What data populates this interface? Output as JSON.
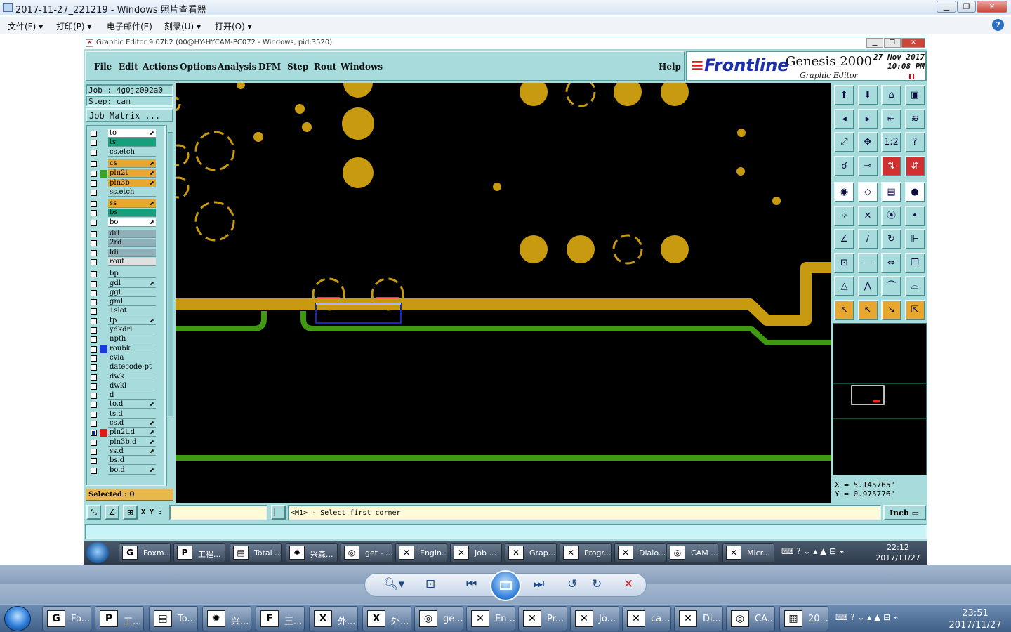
{
  "viewer": {
    "title": "2017-11-27_221219 - Windows 照片查看器",
    "menu": [
      "文件(F)",
      "打印(P)",
      "电子邮件(E)",
      "刻录(U)",
      "打开(O)"
    ],
    "help_icon": "?"
  },
  "genesis": {
    "title": "Graphic Editor 9.07b2 (00@HY-HYCAM-PC072 - Windows, pid:3520)",
    "menu": [
      "File",
      "Edit",
      "Actions",
      "Options",
      "Analysis",
      "DFM",
      "Step",
      "Rout",
      "Windows"
    ],
    "help": "Help",
    "brand": {
      "logo": "Frontline",
      "product": "Genesis 2000",
      "subtitle": "Graphic Editor",
      "date_line1": "27 Nov 2017",
      "date_line2": "10:08 PM"
    },
    "job_label": "Job : 4g0jz092a0",
    "step_label": "Step: cam",
    "job_matrix_button": "Job Matrix ...",
    "layers": [
      {
        "name": "to",
        "color": "#ffffff",
        "edit": "⬈",
        "checked": false,
        "swatch": null
      },
      {
        "name": "ts",
        "color": "#14a07a",
        "edit": "",
        "checked": false,
        "swatch": null
      },
      {
        "name": "cs.etch",
        "color": "#a8dcdc",
        "edit": "",
        "checked": false,
        "swatch": null
      },
      {
        "name": "cs",
        "color": "#e8a830",
        "edit": "⬈",
        "checked": false,
        "swatch": null
      },
      {
        "name": "pln2t",
        "color": "#e8a830",
        "edit": "⬈",
        "checked": false,
        "swatch": "#3aa02a"
      },
      {
        "name": "pln3b",
        "color": "#e8a830",
        "edit": "⬈",
        "checked": false,
        "swatch": null
      },
      {
        "name": "ss.etch",
        "color": "#a8dcdc",
        "edit": "",
        "checked": false,
        "swatch": null
      },
      {
        "name": "ss",
        "color": "#e8a830",
        "edit": "⬈",
        "checked": false,
        "swatch": null
      },
      {
        "name": "bs",
        "color": "#14a07a",
        "edit": "",
        "checked": false,
        "swatch": null
      },
      {
        "name": "bo",
        "color": "#ffffff",
        "edit": "⬈",
        "checked": false,
        "swatch": null
      },
      {
        "name": "drl",
        "color": "#8fb0b8",
        "edit": "",
        "checked": false,
        "swatch": null
      },
      {
        "name": "2rd",
        "color": "#8fb0b8",
        "edit": "",
        "checked": false,
        "swatch": null
      },
      {
        "name": "ldi",
        "color": "#8fb0b8",
        "edit": "",
        "checked": false,
        "swatch": null
      },
      {
        "name": "rout",
        "color": "#e0e0e0",
        "edit": "",
        "checked": false,
        "swatch": null
      },
      {
        "name": "bp",
        "color": "#a8dcdc",
        "edit": "",
        "checked": false,
        "swatch": null
      },
      {
        "name": "gdl",
        "color": "#a8dcdc",
        "edit": "⬈",
        "checked": false,
        "swatch": null
      },
      {
        "name": "ggl",
        "color": "#a8dcdc",
        "edit": "",
        "checked": false,
        "swatch": null
      },
      {
        "name": "gml",
        "color": "#a8dcdc",
        "edit": "",
        "checked": false,
        "swatch": null
      },
      {
        "name": "1slot",
        "color": "#a8dcdc",
        "edit": "",
        "checked": false,
        "swatch": null
      },
      {
        "name": "tp",
        "color": "#a8dcdc",
        "edit": "⬈",
        "checked": false,
        "swatch": null
      },
      {
        "name": "ydkdrl",
        "color": "#a8dcdc",
        "edit": "",
        "checked": false,
        "swatch": null
      },
      {
        "name": "npth",
        "color": "#a8dcdc",
        "edit": "",
        "checked": false,
        "swatch": null
      },
      {
        "name": "roubk",
        "color": "#a8dcdc",
        "edit": "",
        "checked": false,
        "swatch": "#1a3ae0"
      },
      {
        "name": "cvia",
        "color": "#a8dcdc",
        "edit": "",
        "checked": false,
        "swatch": null
      },
      {
        "name": "datecode-pt",
        "color": "#a8dcdc",
        "edit": "",
        "checked": false,
        "swatch": null
      },
      {
        "name": "dwk",
        "color": "#a8dcdc",
        "edit": "",
        "checked": false,
        "swatch": null
      },
      {
        "name": "dwkl",
        "color": "#a8dcdc",
        "edit": "",
        "checked": false,
        "swatch": null
      },
      {
        "name": "d",
        "color": "#a8dcdc",
        "edit": "",
        "checked": false,
        "swatch": null
      },
      {
        "name": "to.d",
        "color": "#a8dcdc",
        "edit": "⬈",
        "checked": false,
        "swatch": null
      },
      {
        "name": "ts.d",
        "color": "#a8dcdc",
        "edit": "",
        "checked": false,
        "swatch": null
      },
      {
        "name": "cs.d",
        "color": "#a8dcdc",
        "edit": "⬈",
        "checked": false,
        "swatch": null
      },
      {
        "name": "pln2t.d",
        "color": "#a8dcdc",
        "edit": "⬈",
        "checked": true,
        "swatch": "#e01a1a"
      },
      {
        "name": "pln3b.d",
        "color": "#a8dcdc",
        "edit": "⬈",
        "checked": false,
        "swatch": null
      },
      {
        "name": "ss.d",
        "color": "#a8dcdc",
        "edit": "⬈",
        "checked": false,
        "swatch": null
      },
      {
        "name": "bs.d",
        "color": "#a8dcdc",
        "edit": "",
        "checked": false,
        "swatch": null
      },
      {
        "name": "bo.d",
        "color": "#a8dcdc",
        "edit": "⬈",
        "checked": false,
        "swatch": null
      }
    ],
    "selected": "Selected : 0",
    "coords": {
      "x": "X = 5.145765\"",
      "y": "Y = 0.975776\""
    },
    "xy_label": "X Y :",
    "xy_value": "",
    "status_message": "<M1> - Select first corner",
    "unit": "Inch",
    "colors": {
      "board": "#000000",
      "copper": "#c89a10",
      "trace_green": "#3f9a12",
      "panel": "#a8dcdc",
      "highlight": "#ff2a55",
      "selection": "#1428c8"
    }
  },
  "inner_taskbar": {
    "items": [
      "Foxm...",
      "工程...",
      "Total ...",
      "兴森...",
      "get - ...",
      "Engin...",
      "Job ...",
      "Grap...",
      "Progr...",
      "Dialo...",
      "CAM ...",
      "Micr..."
    ],
    "time": "22:12",
    "date": "2017/11/27"
  },
  "outer_taskbar": {
    "items": [
      "Fo...",
      "工...",
      "To...",
      "兴...",
      "王...",
      "外...",
      "外...",
      "ge...",
      "En...",
      "Pr...",
      "Jo...",
      "ca...",
      "Di...",
      "CA...",
      "20..."
    ],
    "time": "23:51",
    "date": "2017/11/27"
  }
}
